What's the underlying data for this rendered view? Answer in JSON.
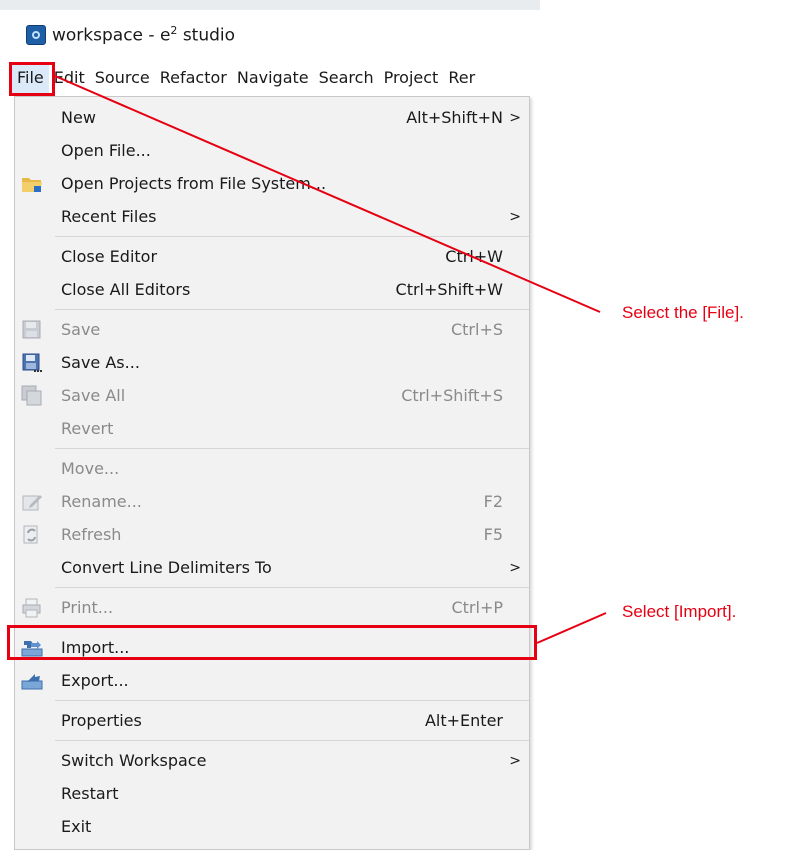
{
  "window": {
    "title": "workspace - e",
    "title_sup": "2",
    "title_suffix": " studio"
  },
  "menubar": [
    "File",
    "Edit",
    "Source",
    "Refactor",
    "Navigate",
    "Search",
    "Project",
    "Rer"
  ],
  "menu": {
    "new": {
      "label": "New",
      "shortcut": "Alt+Shift+N"
    },
    "open_file": {
      "label": "Open File..."
    },
    "open_projects": {
      "label": "Open Projects from File System..."
    },
    "recent_files": {
      "label": "Recent Files"
    },
    "close_editor": {
      "label": "Close Editor",
      "shortcut": "Ctrl+W"
    },
    "close_all": {
      "label": "Close All Editors",
      "shortcut": "Ctrl+Shift+W"
    },
    "save": {
      "label": "Save",
      "shortcut": "Ctrl+S"
    },
    "save_as": {
      "label": "Save As..."
    },
    "save_all": {
      "label": "Save All",
      "shortcut": "Ctrl+Shift+S"
    },
    "revert": {
      "label": "Revert"
    },
    "move": {
      "label": "Move..."
    },
    "rename": {
      "label": "Rename...",
      "shortcut": "F2"
    },
    "refresh": {
      "label": "Refresh",
      "shortcut": "F5"
    },
    "convert": {
      "label": "Convert Line Delimiters To"
    },
    "print": {
      "label": "Print...",
      "shortcut": "Ctrl+P"
    },
    "import": {
      "label": "Import..."
    },
    "export": {
      "label": "Export..."
    },
    "properties": {
      "label": "Properties",
      "shortcut": "Alt+Enter"
    },
    "switch_ws": {
      "label": "Switch Workspace"
    },
    "restart": {
      "label": "Restart"
    },
    "exit": {
      "label": "Exit"
    },
    "submenu_arrow": ">"
  },
  "callouts": {
    "file": "Select the [File].",
    "import": "Select [Import]."
  },
  "colors": {
    "annotation": "#e60012",
    "menu_bg": "#f2f2f2",
    "disabled_text": "#8a8a8a"
  }
}
